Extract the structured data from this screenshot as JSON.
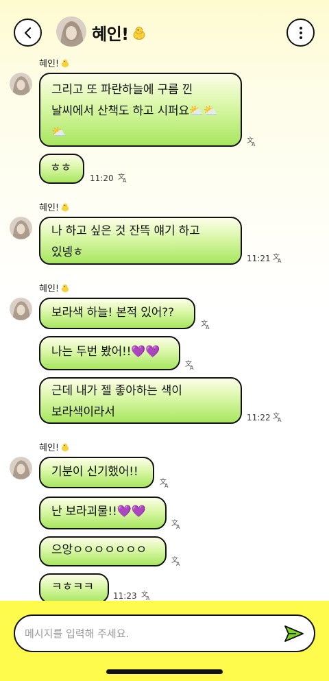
{
  "header": {
    "title": "혜인!",
    "title_emoji": "baby-chick-icon"
  },
  "messages": [
    {
      "sender": "혜인!",
      "text": "그리고 또 파란하늘에 구름 낀 날씨에서 산책도 하고 시퍼요⛅⛅⛅",
      "time": ""
    },
    {
      "sender": "",
      "text": "ㅎㅎ",
      "time": "11:20"
    },
    {
      "sender": "혜인!",
      "text": "나 하고 싶은 것 잔뜩 얘기 하고 있넹ㅎ",
      "time": "11:21"
    },
    {
      "sender": "혜인!",
      "text": "보라색 하늘! 본적 있어??",
      "time": ""
    },
    {
      "sender": "",
      "text": "나는 두번 봤어!!💜💜",
      "time": ""
    },
    {
      "sender": "",
      "text": "근데 내가 젤 좋아하는 색이 보라색이라서",
      "time": "11:22"
    },
    {
      "sender": "혜인!",
      "text": "기분이 신기했어!!",
      "time": ""
    },
    {
      "sender": "",
      "text": "난 보라괴물!!💜💜",
      "time": ""
    },
    {
      "sender": "",
      "text": "으앙ㅇㅇㅇㅇㅇㅇㅇ",
      "time": ""
    },
    {
      "sender": "",
      "text": "ㅋㅎㅋㅋ",
      "time": "11:23"
    }
  ],
  "input": {
    "placeholder": "메시지를 입력해 주세요.",
    "value": ""
  },
  "colors": {
    "bottom_bar": "#fefb4c",
    "bubble_green": "#a8e660",
    "send_icon": "#7ed321"
  }
}
